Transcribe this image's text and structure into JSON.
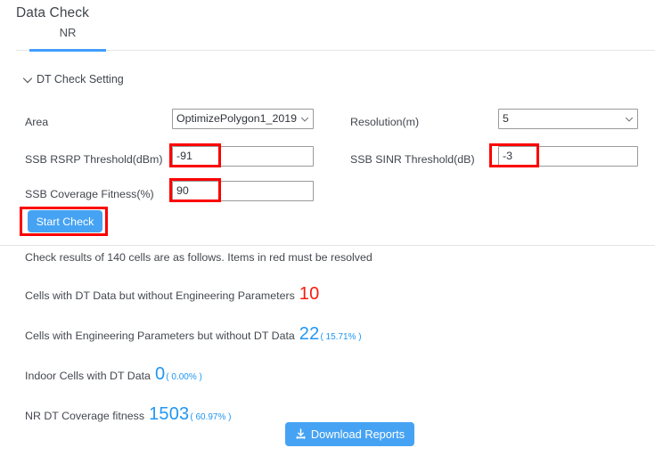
{
  "header": {
    "title": "Data Check"
  },
  "tabs": [
    {
      "label": "NR",
      "active": true
    }
  ],
  "collapse": {
    "label": "DT Check Setting",
    "icon": "chevron-down-icon",
    "expanded": true
  },
  "form": {
    "area": {
      "label": "Area",
      "value": "OptimizePolygon1_2019",
      "control": "select"
    },
    "resolution": {
      "label": "Resolution(m)",
      "value": "5",
      "control": "select"
    },
    "ssb_rsrp_threshold": {
      "label": "SSB RSRP Threshold(dBm)",
      "value": "-91",
      "control": "input"
    },
    "ssb_sinr_threshold": {
      "label": "SSB SINR Threshold(dB)",
      "value": "-3",
      "control": "input"
    },
    "ssb_coverage_fitness": {
      "label": "SSB Coverage Fitness(%)",
      "value": "90",
      "control": "input"
    },
    "start_check_label": "Start Check"
  },
  "results": {
    "summary": "Check results of 140 cells are as follows. Items in red must be resolved",
    "items": [
      {
        "text": "Cells with DT Data but without Engineering Parameters",
        "value": "10",
        "percent": "",
        "color": "red"
      },
      {
        "text": "Cells with Engineering Parameters but without DT Data",
        "value": "22",
        "percent": "( 15.71% )",
        "color": "blue"
      },
      {
        "text": "Indoor Cells with DT Data",
        "value": "0",
        "percent": "( 0.00% )",
        "color": "blue"
      },
      {
        "text": "NR DT Coverage fitness",
        "value": "1503",
        "percent": "( 60.97% )",
        "color": "blue"
      }
    ]
  },
  "footer": {
    "download_label": "Download Reports",
    "download_icon": "download-icon"
  },
  "colors": {
    "accent_blue": "#409eff",
    "button_blue": "#46a3f3",
    "alert_red": "#f71b0e",
    "annotation_red": "#fc0000",
    "stat_blue": "#2196f3"
  }
}
